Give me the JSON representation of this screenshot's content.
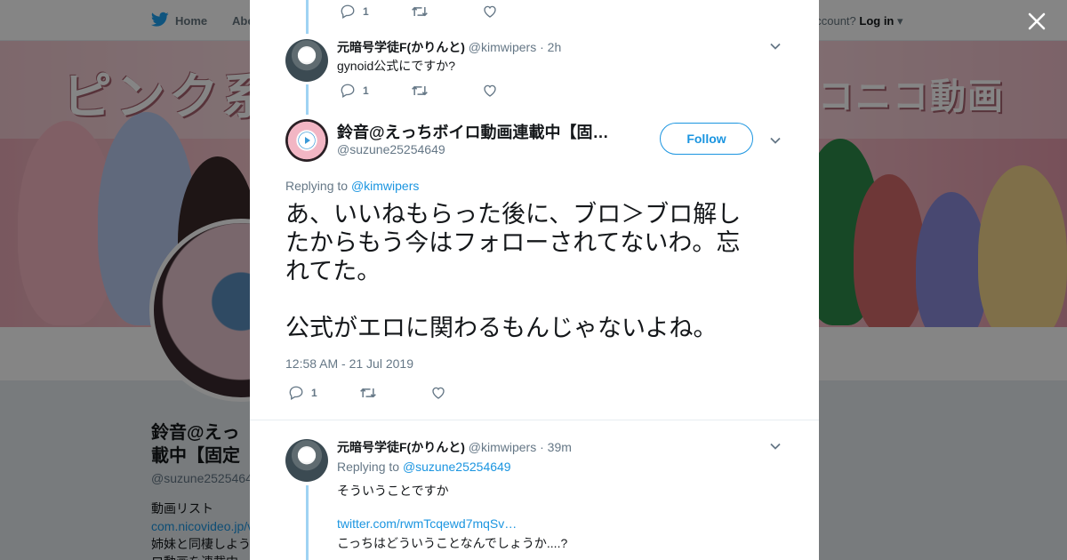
{
  "nav": {
    "home_label": "Home",
    "about_label": "Abo",
    "account_prompt": "account?",
    "login_label": "Log in"
  },
  "banner": {
    "title_left": "ピンク系",
    "title_right": "コニコ動画"
  },
  "profile": {
    "name_line1": "鈴音@えっ",
    "name_line2": "載中【固定",
    "handle": "@suzune2525464",
    "bio_line1": "動画リスト",
    "bio_link": "com.nicovideo.jp/v",
    "bio_line2": "姉妹と同棲しよう",
    "bio_line3": "ロ動画を連載中"
  },
  "modal": {
    "prev_tweet": {
      "reply_count": "1"
    },
    "reply_tweet_1": {
      "name": "元暗号学徒F(かりんと)",
      "handle": "@kimwipers",
      "time": "· 2h",
      "text": "gynoid公式にですか?",
      "reply_count": "1"
    },
    "main_tweet": {
      "name": "鈴音@えっちボイロ動画連載中【固…",
      "handle": "@suzune25254649",
      "follow_label": "Follow",
      "replying_prefix": "Replying to",
      "replying_to": "@kimwipers",
      "text_line1": "あ、いいねもらった後に、ブロ＞ブロ解し",
      "text_line2": "たからもう今はフォローされてないわ。忘",
      "text_line3": "れてた。",
      "text_line4": "公式がエロに関わるもんじゃないよね。",
      "timestamp": "12:58 AM - 21 Jul 2019",
      "reply_count": "1"
    },
    "reply_tweet_2": {
      "name": "元暗号学徒F(かりんと)",
      "handle": "@kimwipers",
      "time": "· 39m",
      "replying_prefix": "Replying to",
      "replying_to": "@suzune25254649",
      "text_line1": "そういうことですか",
      "link": "twitter.com/rwmTcqewd7mqSv…",
      "text_line2": "こっちはどういうことなんでしょうか....?"
    }
  },
  "colors": {
    "accent": "#1b95e0",
    "thread_line": "#9fd3f3",
    "secondary_text": "#657786"
  }
}
